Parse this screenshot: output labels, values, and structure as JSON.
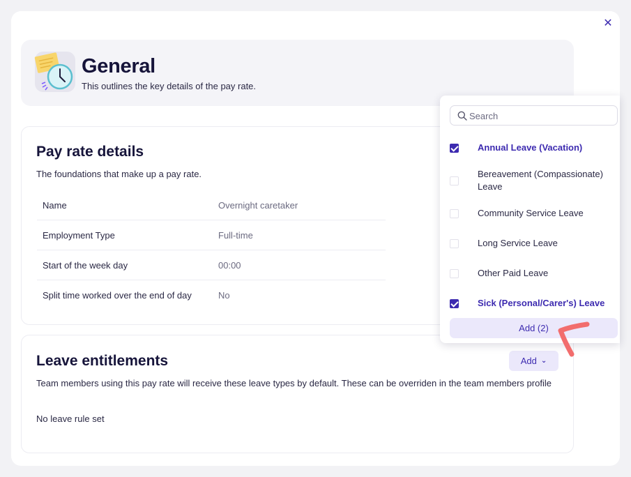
{
  "dialog": {
    "close_icon": "close-icon"
  },
  "header": {
    "title": "General",
    "subtitle": "This outlines the key details of the pay rate.",
    "icon": "clock-document-icon"
  },
  "pay_rate": {
    "title": "Pay rate details",
    "subtitle": "The foundations that make up a pay rate.",
    "rows": [
      {
        "label": "Name",
        "value": "Overnight caretaker"
      },
      {
        "label": "Employment Type",
        "value": "Full-time"
      },
      {
        "label": "Start of the week day",
        "value": "00:00"
      },
      {
        "label": "Split time worked over the end of day",
        "value": "No"
      }
    ]
  },
  "leave": {
    "title": "Leave entitlements",
    "subtitle": "Team members using this pay rate will receive these leave types by default. These can be overriden in the team members profile",
    "empty_text": "No leave rule set",
    "add_label": "Add"
  },
  "dropdown": {
    "search_placeholder": "Search",
    "options": [
      {
        "label": "Annual Leave (Vacation)",
        "checked": true
      },
      {
        "label": "Bereavement (Compassionate) Leave",
        "checked": false
      },
      {
        "label": "Community Service Leave",
        "checked": false
      },
      {
        "label": "Long Service Leave",
        "checked": false
      },
      {
        "label": "Other Paid Leave",
        "checked": false
      },
      {
        "label": "Sick (Personal/Carer's) Leave",
        "checked": true
      }
    ],
    "add_button_label": "Add (2)"
  },
  "colors": {
    "accent": "#3d2bb0",
    "accent_soft": "#ebe8fb",
    "annotation": "#f26d6d"
  }
}
